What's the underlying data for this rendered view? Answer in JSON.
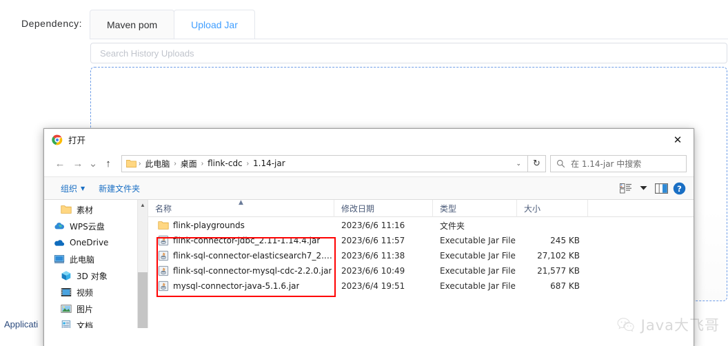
{
  "background": {
    "dependency_label": "Dependency:",
    "tabs": [
      {
        "label": "Maven pom",
        "active": false
      },
      {
        "label": "Upload Jar",
        "active": true
      }
    ],
    "search_history": {
      "placeholder": "Search History Uploads",
      "value": ""
    },
    "dropzone": {
      "icon": "upload-cloud-icon"
    },
    "bottom_left_text": "Applicati",
    "accent_color": "#409eff",
    "dropzone_border_color": "#6f9ee8"
  },
  "dialog": {
    "title": "打开",
    "app_icon": "chrome-icon",
    "close_label": "✕",
    "nav": {
      "back": "←",
      "forward": "→",
      "recent": "⌄",
      "up": "↑",
      "breadcrumb": [
        "此电脑",
        "桌面",
        "flink-cdc",
        "1.14-jar"
      ],
      "breadcrumb_separator": "›",
      "dropdown_caret": "⌄",
      "refresh": "↻",
      "search": {
        "placeholder": "在 1.14-jar 中搜索",
        "value": "",
        "icon": "search-icon"
      }
    },
    "commandbar": {
      "organize": "组织",
      "organize_caret": "▼",
      "new_folder": "新建文件夹",
      "view_icon": "list-view-icon",
      "view_caret": "▼",
      "preview_icon": "preview-pane-icon",
      "help_icon": "help-icon"
    },
    "nav_pane": [
      {
        "label": "素材",
        "icon": "folder-icon",
        "indent": 1
      },
      {
        "label": "WPS云盘",
        "icon": "wps-cloud-icon",
        "indent": 0
      },
      {
        "label": "OneDrive",
        "icon": "onedrive-icon",
        "indent": 0
      },
      {
        "label": "此电脑",
        "icon": "this-pc-icon",
        "indent": 0
      },
      {
        "label": "3D 对象",
        "icon": "3d-objects-icon",
        "indent": 1
      },
      {
        "label": "视频",
        "icon": "videos-icon",
        "indent": 1
      },
      {
        "label": "图片",
        "icon": "pictures-icon",
        "indent": 1
      },
      {
        "label": "文档",
        "icon": "documents-icon",
        "indent": 1
      }
    ],
    "columns": {
      "name": "名称",
      "date": "修改日期",
      "type": "类型",
      "size": "大小",
      "sorted_by": "名称",
      "sort_direction": "ascending"
    },
    "files": [
      {
        "name": "flink-playgrounds",
        "date": "2023/6/6 11:16",
        "type": "文件夹",
        "size": "",
        "icon": "folder-icon"
      },
      {
        "name": "flink-connector-jdbc_2.11-1.14.4.jar",
        "date": "2023/6/6 11:57",
        "type": "Executable Jar File",
        "size": "245 KB",
        "icon": "jar-file-icon"
      },
      {
        "name": "flink-sql-connector-elasticsearch7_2.1...",
        "date": "2023/6/6 11:38",
        "type": "Executable Jar File",
        "size": "27,102 KB",
        "icon": "jar-file-icon"
      },
      {
        "name": "flink-sql-connector-mysql-cdc-2.2.0.jar",
        "date": "2023/6/6 10:49",
        "type": "Executable Jar File",
        "size": "21,577 KB",
        "icon": "jar-file-icon"
      },
      {
        "name": "mysql-connector-java-5.1.6.jar",
        "date": "2023/6/4 19:51",
        "type": "Executable Jar File",
        "size": "687 KB",
        "icon": "jar-file-icon"
      }
    ]
  },
  "annotation": {
    "highlight_color": "#ff0000",
    "shape": "rectangle"
  },
  "watermark": {
    "text": "Java大飞哥",
    "icon": "wechat-icon"
  }
}
